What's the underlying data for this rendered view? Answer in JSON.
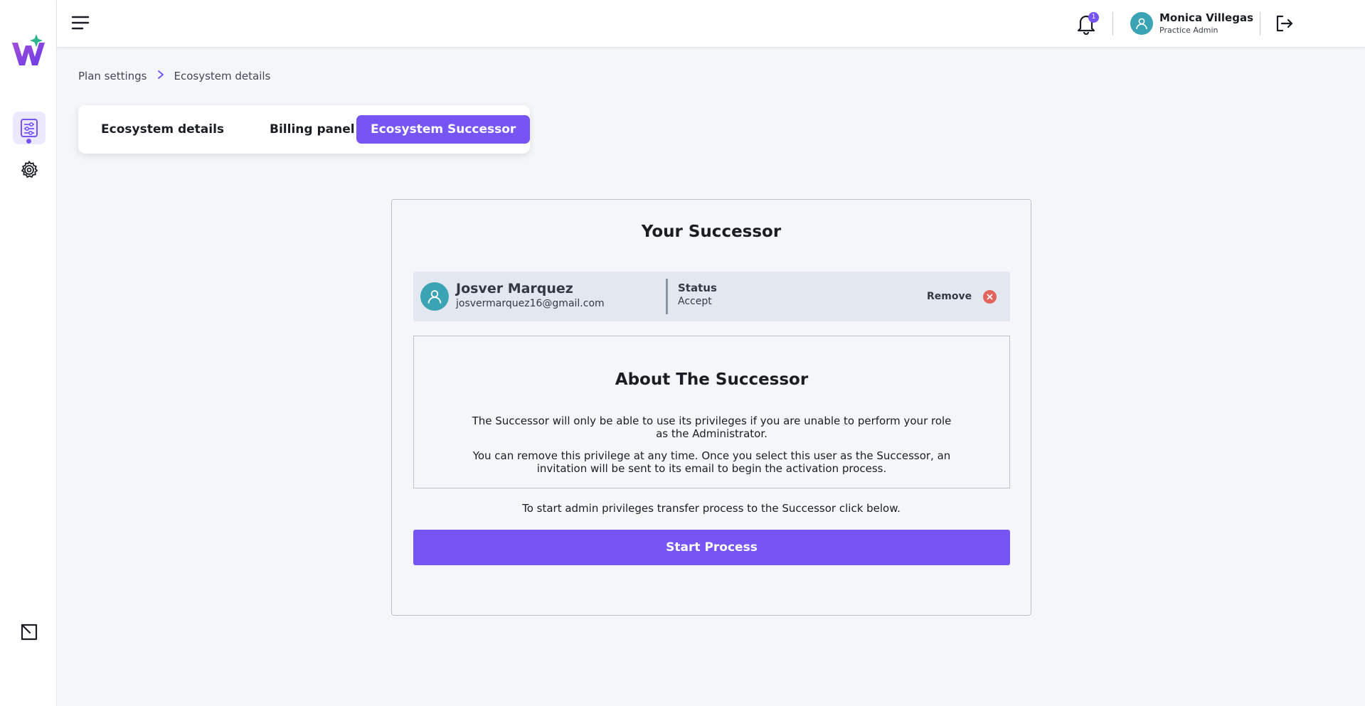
{
  "app": {
    "logo_icon": "w-brand-logo-icon",
    "accent_color": "#7755f5"
  },
  "sidebar": {
    "items": [
      {
        "name": "plan-settings",
        "icon": "sliders-document-icon",
        "active": true
      },
      {
        "name": "settings",
        "icon": "gear-icon",
        "active": false
      }
    ],
    "bottom_icon": "exit-window-icon"
  },
  "header": {
    "menu_icon": "hamburger-icon",
    "notifications": {
      "icon": "bell-icon",
      "count": "1"
    },
    "user": {
      "name": "Monica Villegas",
      "role": "Practice Admin",
      "avatar_color": "#3aa3b4"
    },
    "logout_icon": "logout-icon"
  },
  "breadcrumb": {
    "items": [
      "Plan settings",
      "Ecosystem details"
    ]
  },
  "tabs": [
    {
      "label": "Ecosystem details",
      "active": false
    },
    {
      "label": "Billing panel",
      "active": false
    },
    {
      "label": "Ecosystem Successor",
      "active": true
    }
  ],
  "successor": {
    "title": "Your Successor",
    "name": "Josver Marquez",
    "email": "josvermarquez16@gmail.com",
    "status_label": "Status",
    "status_value": "Accept",
    "remove_label": "Remove"
  },
  "about": {
    "title": "About The Successor",
    "paragraph_1": "The Successor will only be able to use its privileges if you are unable to perform your role as the Administrator.",
    "paragraph_2": "You can remove this privilege at any time. Once you select this user as the Successor, an invitation will be sent to its email to begin the activation process."
  },
  "start": {
    "hint": "To start admin privileges transfer process to the Successor click below.",
    "button_label": "Start Process"
  }
}
